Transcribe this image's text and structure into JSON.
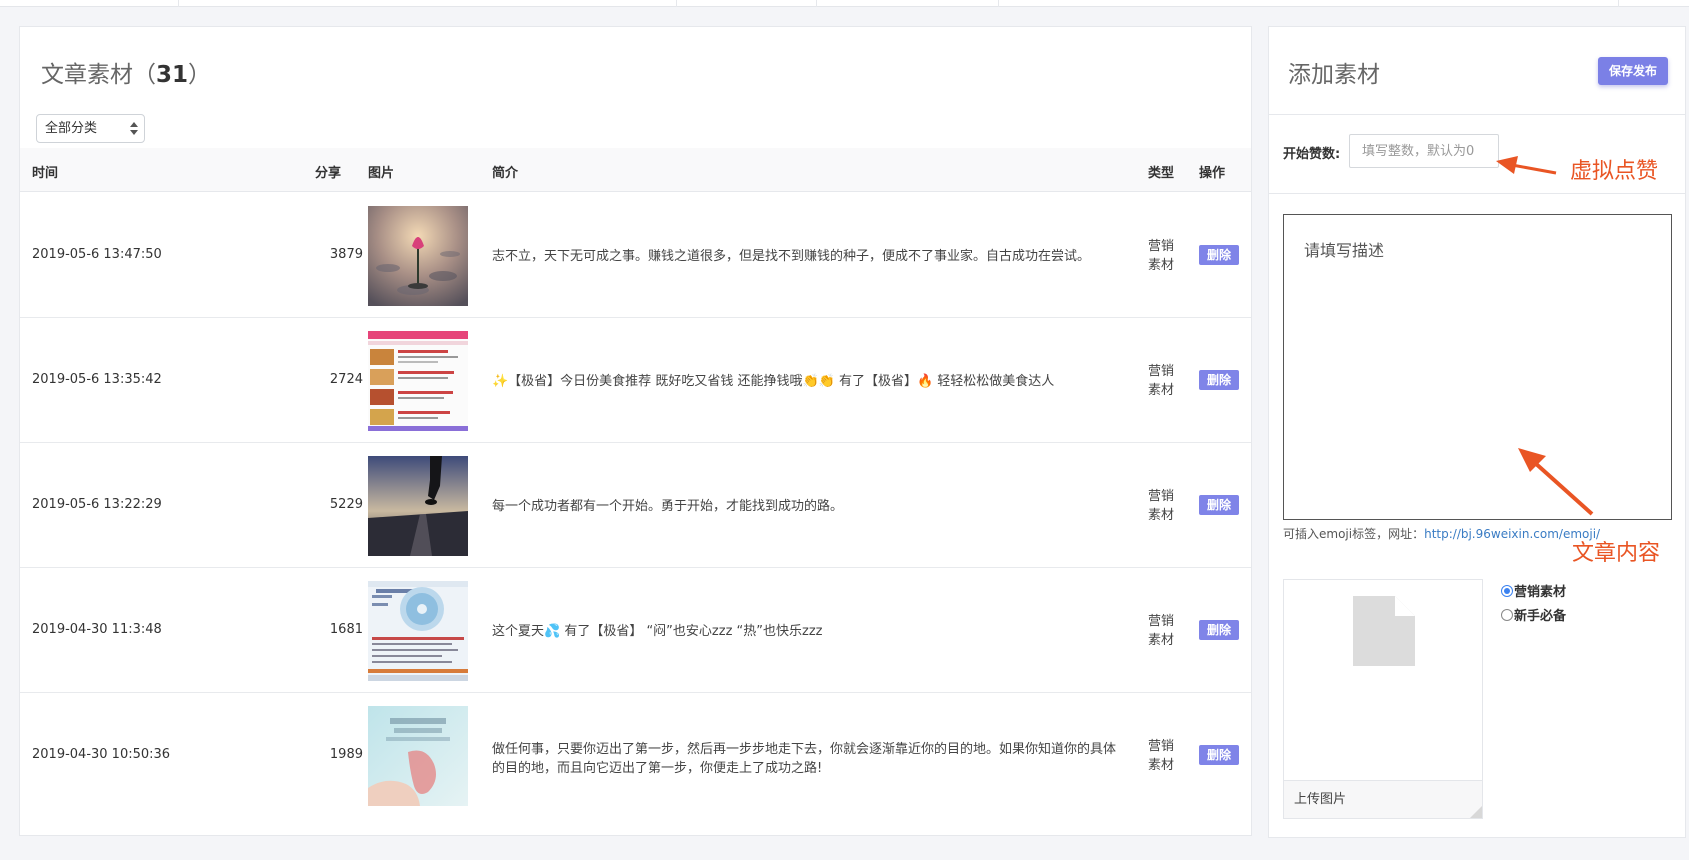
{
  "list": {
    "title": "文章素材（",
    "count": "31",
    "title_suffix": "）",
    "category_filter": "全部分类",
    "columns": [
      "时间",
      "分享",
      "图片",
      "简介",
      "类型",
      "操作"
    ],
    "rows": [
      {
        "time": "2019-05-6 13:47:50",
        "share": "3879",
        "intro": "志不立，天下无可成之事。赚钱之道很多，但是找不到赚钱的种子，便成不了事业家。自古成功在尝试。",
        "type": "营销素材",
        "action": "删除"
      },
      {
        "time": "2019-05-6 13:35:42",
        "share": "2724",
        "intro": "✨【极省】今日份美食推荐 既好吃又省钱 还能挣钱哦👏👏 有了【极省】🔥 轻轻松松做美食达人",
        "type": "营销素材",
        "action": "删除"
      },
      {
        "time": "2019-05-6 13:22:29",
        "share": "5229",
        "intro": "每一个成功者都有一个开始。勇于开始，才能找到成功的路。",
        "type": "营销素材",
        "action": "删除"
      },
      {
        "time": "2019-04-30 11:3:48",
        "share": "1681",
        "intro": "这个夏天💦 有了【极省】 “闷”也安心zzz “热”也快乐zzz",
        "type": "营销素材",
        "action": "删除"
      },
      {
        "time": "2019-04-30 10:50:36",
        "share": "1989",
        "intro": "做任何事，只要你迈出了第一步，然后再一步步地走下去，你就会逐渐靠近你的目的地。如果你知道你的具体的目的地，而且向它迈出了第一步，你便走上了成功之路!",
        "type": "营销素材",
        "action": "删除"
      }
    ]
  },
  "form": {
    "title": "添加素材",
    "publish_button": "保存发布",
    "like_label": "开始赞数:",
    "like_placeholder": "填写整数，默认为0",
    "desc_placeholder": "请填写描述",
    "emoji_tip": "可插入emoji标签，网址：",
    "emoji_link": "http://bj.96weixin.com/emoji/",
    "upload_label": "上传图片",
    "type_options": [
      {
        "label": "营销素材",
        "checked": true
      },
      {
        "label": "新手必备",
        "checked": false
      }
    ]
  },
  "annotations": {
    "virtual_likes": "虚拟点赞",
    "article_content": "文章内容"
  },
  "colors": {
    "accent": "#7b80e6",
    "annotation": "#e95524",
    "link": "#3a7cc4"
  }
}
